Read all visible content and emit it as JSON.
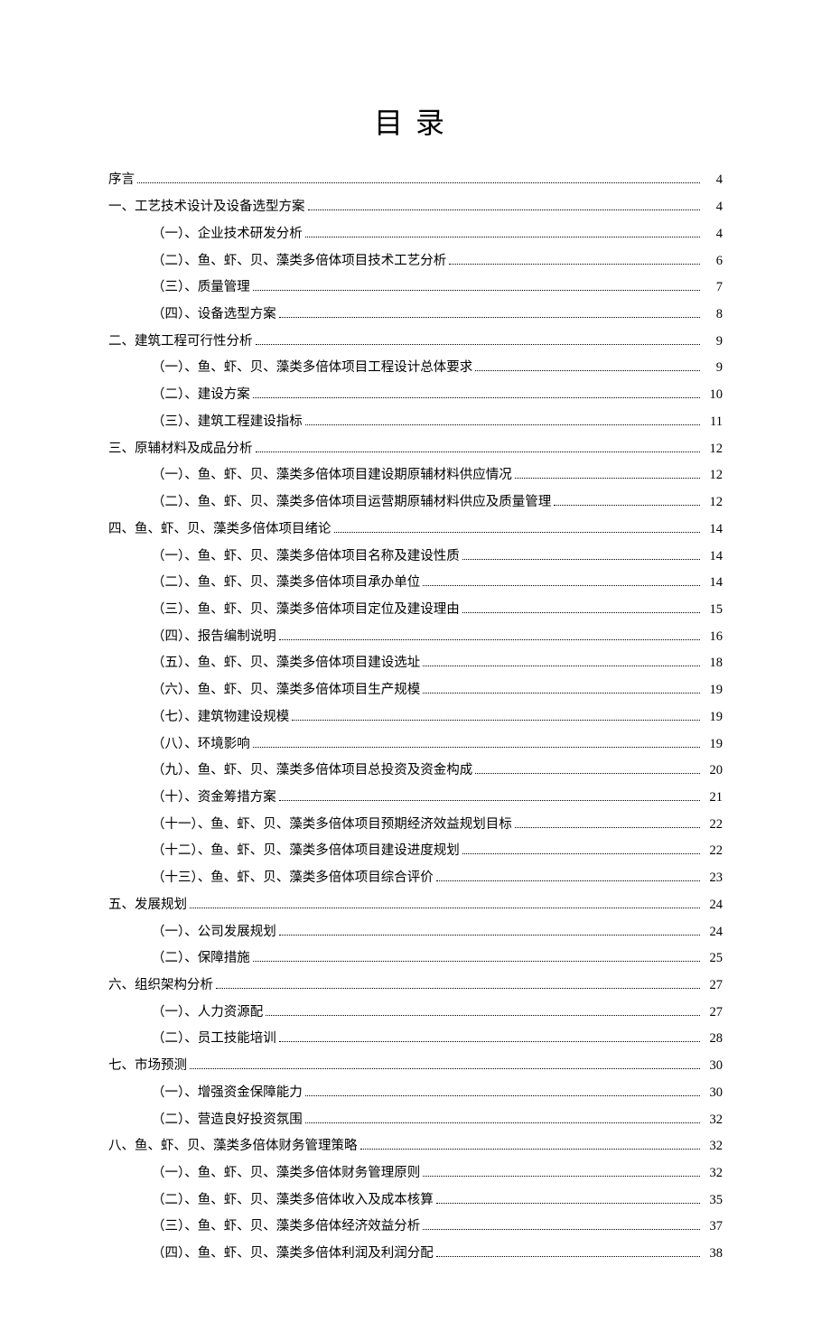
{
  "title": "目录",
  "toc": [
    {
      "level": 0,
      "label": "序言",
      "page": "4"
    },
    {
      "level": 0,
      "label": "一、工艺技术设计及设备选型方案",
      "page": "4"
    },
    {
      "level": 1,
      "label": "（一）、企业技术研发分析",
      "page": "4"
    },
    {
      "level": 1,
      "label": "（二）、鱼、虾、贝、藻类多倍体项目技术工艺分析",
      "page": "6"
    },
    {
      "level": 1,
      "label": "（三）、质量管理",
      "page": "7"
    },
    {
      "level": 1,
      "label": "（四）、设备选型方案",
      "page": "8"
    },
    {
      "level": 0,
      "label": "二、建筑工程可行性分析",
      "page": "9"
    },
    {
      "level": 1,
      "label": "（一）、鱼、虾、贝、藻类多倍体项目工程设计总体要求",
      "page": "9"
    },
    {
      "level": 1,
      "label": "（二）、建设方案",
      "page": "10"
    },
    {
      "level": 1,
      "label": "（三）、建筑工程建设指标",
      "page": "11"
    },
    {
      "level": 0,
      "label": "三、原辅材料及成品分析",
      "page": "12"
    },
    {
      "level": 1,
      "label": "（一）、鱼、虾、贝、藻类多倍体项目建设期原辅材料供应情况",
      "page": "12"
    },
    {
      "level": 1,
      "label": "（二）、鱼、虾、贝、藻类多倍体项目运营期原辅材料供应及质量管理",
      "page": "12"
    },
    {
      "level": 0,
      "label": "四、鱼、虾、贝、藻类多倍体项目绪论",
      "page": "14"
    },
    {
      "level": 1,
      "label": "（一）、鱼、虾、贝、藻类多倍体项目名称及建设性质",
      "page": "14"
    },
    {
      "level": 1,
      "label": "（二）、鱼、虾、贝、藻类多倍体项目承办单位",
      "page": "14"
    },
    {
      "level": 1,
      "label": "（三）、鱼、虾、贝、藻类多倍体项目定位及建设理由",
      "page": "15"
    },
    {
      "level": 1,
      "label": "（四）、报告编制说明",
      "page": "16"
    },
    {
      "level": 1,
      "label": "（五）、鱼、虾、贝、藻类多倍体项目建设选址",
      "page": "18"
    },
    {
      "level": 1,
      "label": "（六）、鱼、虾、贝、藻类多倍体项目生产规模",
      "page": "19"
    },
    {
      "level": 1,
      "label": "（七）、建筑物建设规模",
      "page": "19"
    },
    {
      "level": 1,
      "label": "（八）、环境影响",
      "page": "19"
    },
    {
      "level": 1,
      "label": "（九）、鱼、虾、贝、藻类多倍体项目总投资及资金构成",
      "page": "20"
    },
    {
      "level": 1,
      "label": "（十）、资金筹措方案",
      "page": "21"
    },
    {
      "level": 1,
      "label": "（十一）、鱼、虾、贝、藻类多倍体项目预期经济效益规划目标",
      "page": "22"
    },
    {
      "level": 1,
      "label": "（十二）、鱼、虾、贝、藻类多倍体项目建设进度规划",
      "page": "22"
    },
    {
      "level": 1,
      "label": "（十三）、鱼、虾、贝、藻类多倍体项目综合评价",
      "page": "23"
    },
    {
      "level": 0,
      "label": "五、发展规划",
      "page": "24"
    },
    {
      "level": 1,
      "label": "（一）、公司发展规划",
      "page": "24"
    },
    {
      "level": 1,
      "label": "（二）、保障措施",
      "page": "25"
    },
    {
      "level": 0,
      "label": "六、组织架构分析",
      "page": "27"
    },
    {
      "level": 1,
      "label": "（一）、人力资源配",
      "page": "27"
    },
    {
      "level": 1,
      "label": "（二）、员工技能培训",
      "page": "28"
    },
    {
      "level": 0,
      "label": "七、市场预测",
      "page": "30"
    },
    {
      "level": 1,
      "label": "（一）、增强资金保障能力",
      "page": "30"
    },
    {
      "level": 1,
      "label": "（二）、营造良好投资氛围",
      "page": "32"
    },
    {
      "level": 0,
      "label": "八、鱼、虾、贝、藻类多倍体财务管理策略",
      "page": "32"
    },
    {
      "level": 1,
      "label": "（一）、鱼、虾、贝、藻类多倍体财务管理原则",
      "page": "32"
    },
    {
      "level": 1,
      "label": "（二）、鱼、虾、贝、藻类多倍体收入及成本核算",
      "page": "35"
    },
    {
      "level": 1,
      "label": "（三）、鱼、虾、贝、藻类多倍体经济效益分析",
      "page": "37"
    },
    {
      "level": 1,
      "label": "（四）、鱼、虾、贝、藻类多倍体利润及利润分配",
      "page": "38"
    }
  ]
}
